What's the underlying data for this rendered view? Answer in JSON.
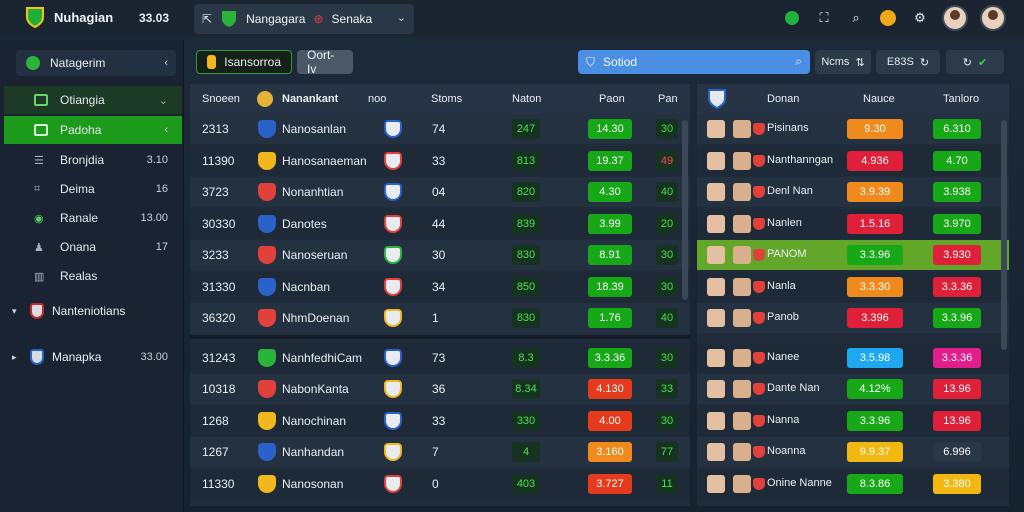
{
  "topbar": {
    "brand_name": "Nuhagian",
    "brand_value": "33.03",
    "match_title": "Nangagara",
    "match_team": "Senaka",
    "icons": [
      "grid-icon",
      "chat-icon",
      "search-icon",
      "coin-icon",
      "settings-icon"
    ]
  },
  "sidebar": {
    "header": "Natagerim",
    "items": [
      {
        "label": "Otiangia",
        "value": ""
      },
      {
        "label": "Padoha",
        "value": ""
      },
      {
        "label": "Bronjdia",
        "value": "3.10"
      },
      {
        "label": "Deima",
        "value": "16"
      },
      {
        "label": "Ranale",
        "value": "13.00"
      },
      {
        "label": "Onana",
        "value": "17"
      },
      {
        "label": "Realas",
        "value": ""
      }
    ],
    "groups": [
      {
        "label": "Nanteniotians",
        "value": ""
      },
      {
        "label": "Manapka",
        "value": "33.00"
      }
    ]
  },
  "toolbar": {
    "primary": "Isansorroa",
    "secondary": "Oort-Iv",
    "search_value": "Sotiod",
    "btn1": "Ncms",
    "btn2": "E83S"
  },
  "left_table": {
    "headers": [
      "Snoeen",
      "Nanankant",
      "noo",
      "Stoms",
      "Naton",
      "Paon",
      "Pan"
    ],
    "rows": [
      {
        "id": "2313",
        "name": "Nanosanlan",
        "n": "74",
        "a": "247",
        "b": "14.30",
        "c": "30"
      },
      {
        "id": "11390",
        "name": "Hanosanaeman",
        "n": "33",
        "a": "813",
        "b": "19.37",
        "c": "49"
      },
      {
        "id": "3723",
        "name": "Nonanhtian",
        "n": "04",
        "a": "820",
        "b": "4.30",
        "c": "40"
      },
      {
        "id": "30330",
        "name": "Danotes",
        "n": "44",
        "a": "839",
        "b": "3.99",
        "c": "20"
      },
      {
        "id": "3233",
        "name": "Nanoseruan",
        "n": "30",
        "a": "830",
        "b": "8.91",
        "c": "30"
      },
      {
        "id": "31330",
        "name": "Nacnban",
        "n": "34",
        "a": "850",
        "b": "18.39",
        "c": "30"
      },
      {
        "id": "36320",
        "name": "NhmDoenan",
        "n": "1",
        "a": "830",
        "b": "1.76",
        "c": "40"
      },
      {
        "id": "31243",
        "name": "NanhfedhiCam",
        "n": "73",
        "a": "8.3",
        "b": "3.3.36",
        "c": "30"
      },
      {
        "id": "10318",
        "name": "NabonKanta",
        "n": "36",
        "a": "8.34",
        "b": "4.130",
        "c": "33"
      },
      {
        "id": "1268",
        "name": "Nanochinan",
        "n": "33",
        "a": "330",
        "b": "4.00",
        "c": "30"
      },
      {
        "id": "1267",
        "name": "Nanhandan",
        "n": "7",
        "a": "4",
        "b": "3.160",
        "c": "77"
      },
      {
        "id": "11330",
        "name": "Nanosonan",
        "n": "0",
        "a": "403",
        "b": "3.727",
        "c": "11"
      }
    ]
  },
  "right_table": {
    "headers": [
      "Donan",
      "Nauce",
      "Tanloro"
    ],
    "rows": [
      {
        "name": "Pisinans",
        "a": "9.30",
        "b": "6.310"
      },
      {
        "name": "Nanthanngan",
        "a": "4.936",
        "b": "4.70"
      },
      {
        "name": "Denl Nan",
        "a": "3.9.39",
        "b": "3.938"
      },
      {
        "name": "Nanlen",
        "a": "1.5.16",
        "b": "3.970"
      },
      {
        "name": "PANOM",
        "a": "3.3.96",
        "b": "3.930"
      },
      {
        "name": "Nanla",
        "a": "3.3.30",
        "b": "3.3.36"
      },
      {
        "name": "Panob",
        "a": "3.396",
        "b": "3.3.96"
      },
      {
        "name": "Nanee",
        "a": "3.5.98",
        "b": "3.3.36"
      },
      {
        "name": "Dante Nan",
        "a": "4.12%",
        "b": "13.96"
      },
      {
        "name": "Nanna",
        "a": "3.3.96",
        "b": "13.96"
      },
      {
        "name": "Noanna",
        "a": "9.9.37",
        "b": "6.996"
      },
      {
        "name": "Onine Nanne",
        "a": "8.3.86",
        "b": "3.380"
      }
    ]
  },
  "colors": {
    "green": "#16a816",
    "orange": "#f08a1c",
    "red": "#e01f38",
    "blue": "#1ea8ef",
    "magenta": "#e21d8c",
    "yellow": "#f2b710"
  }
}
